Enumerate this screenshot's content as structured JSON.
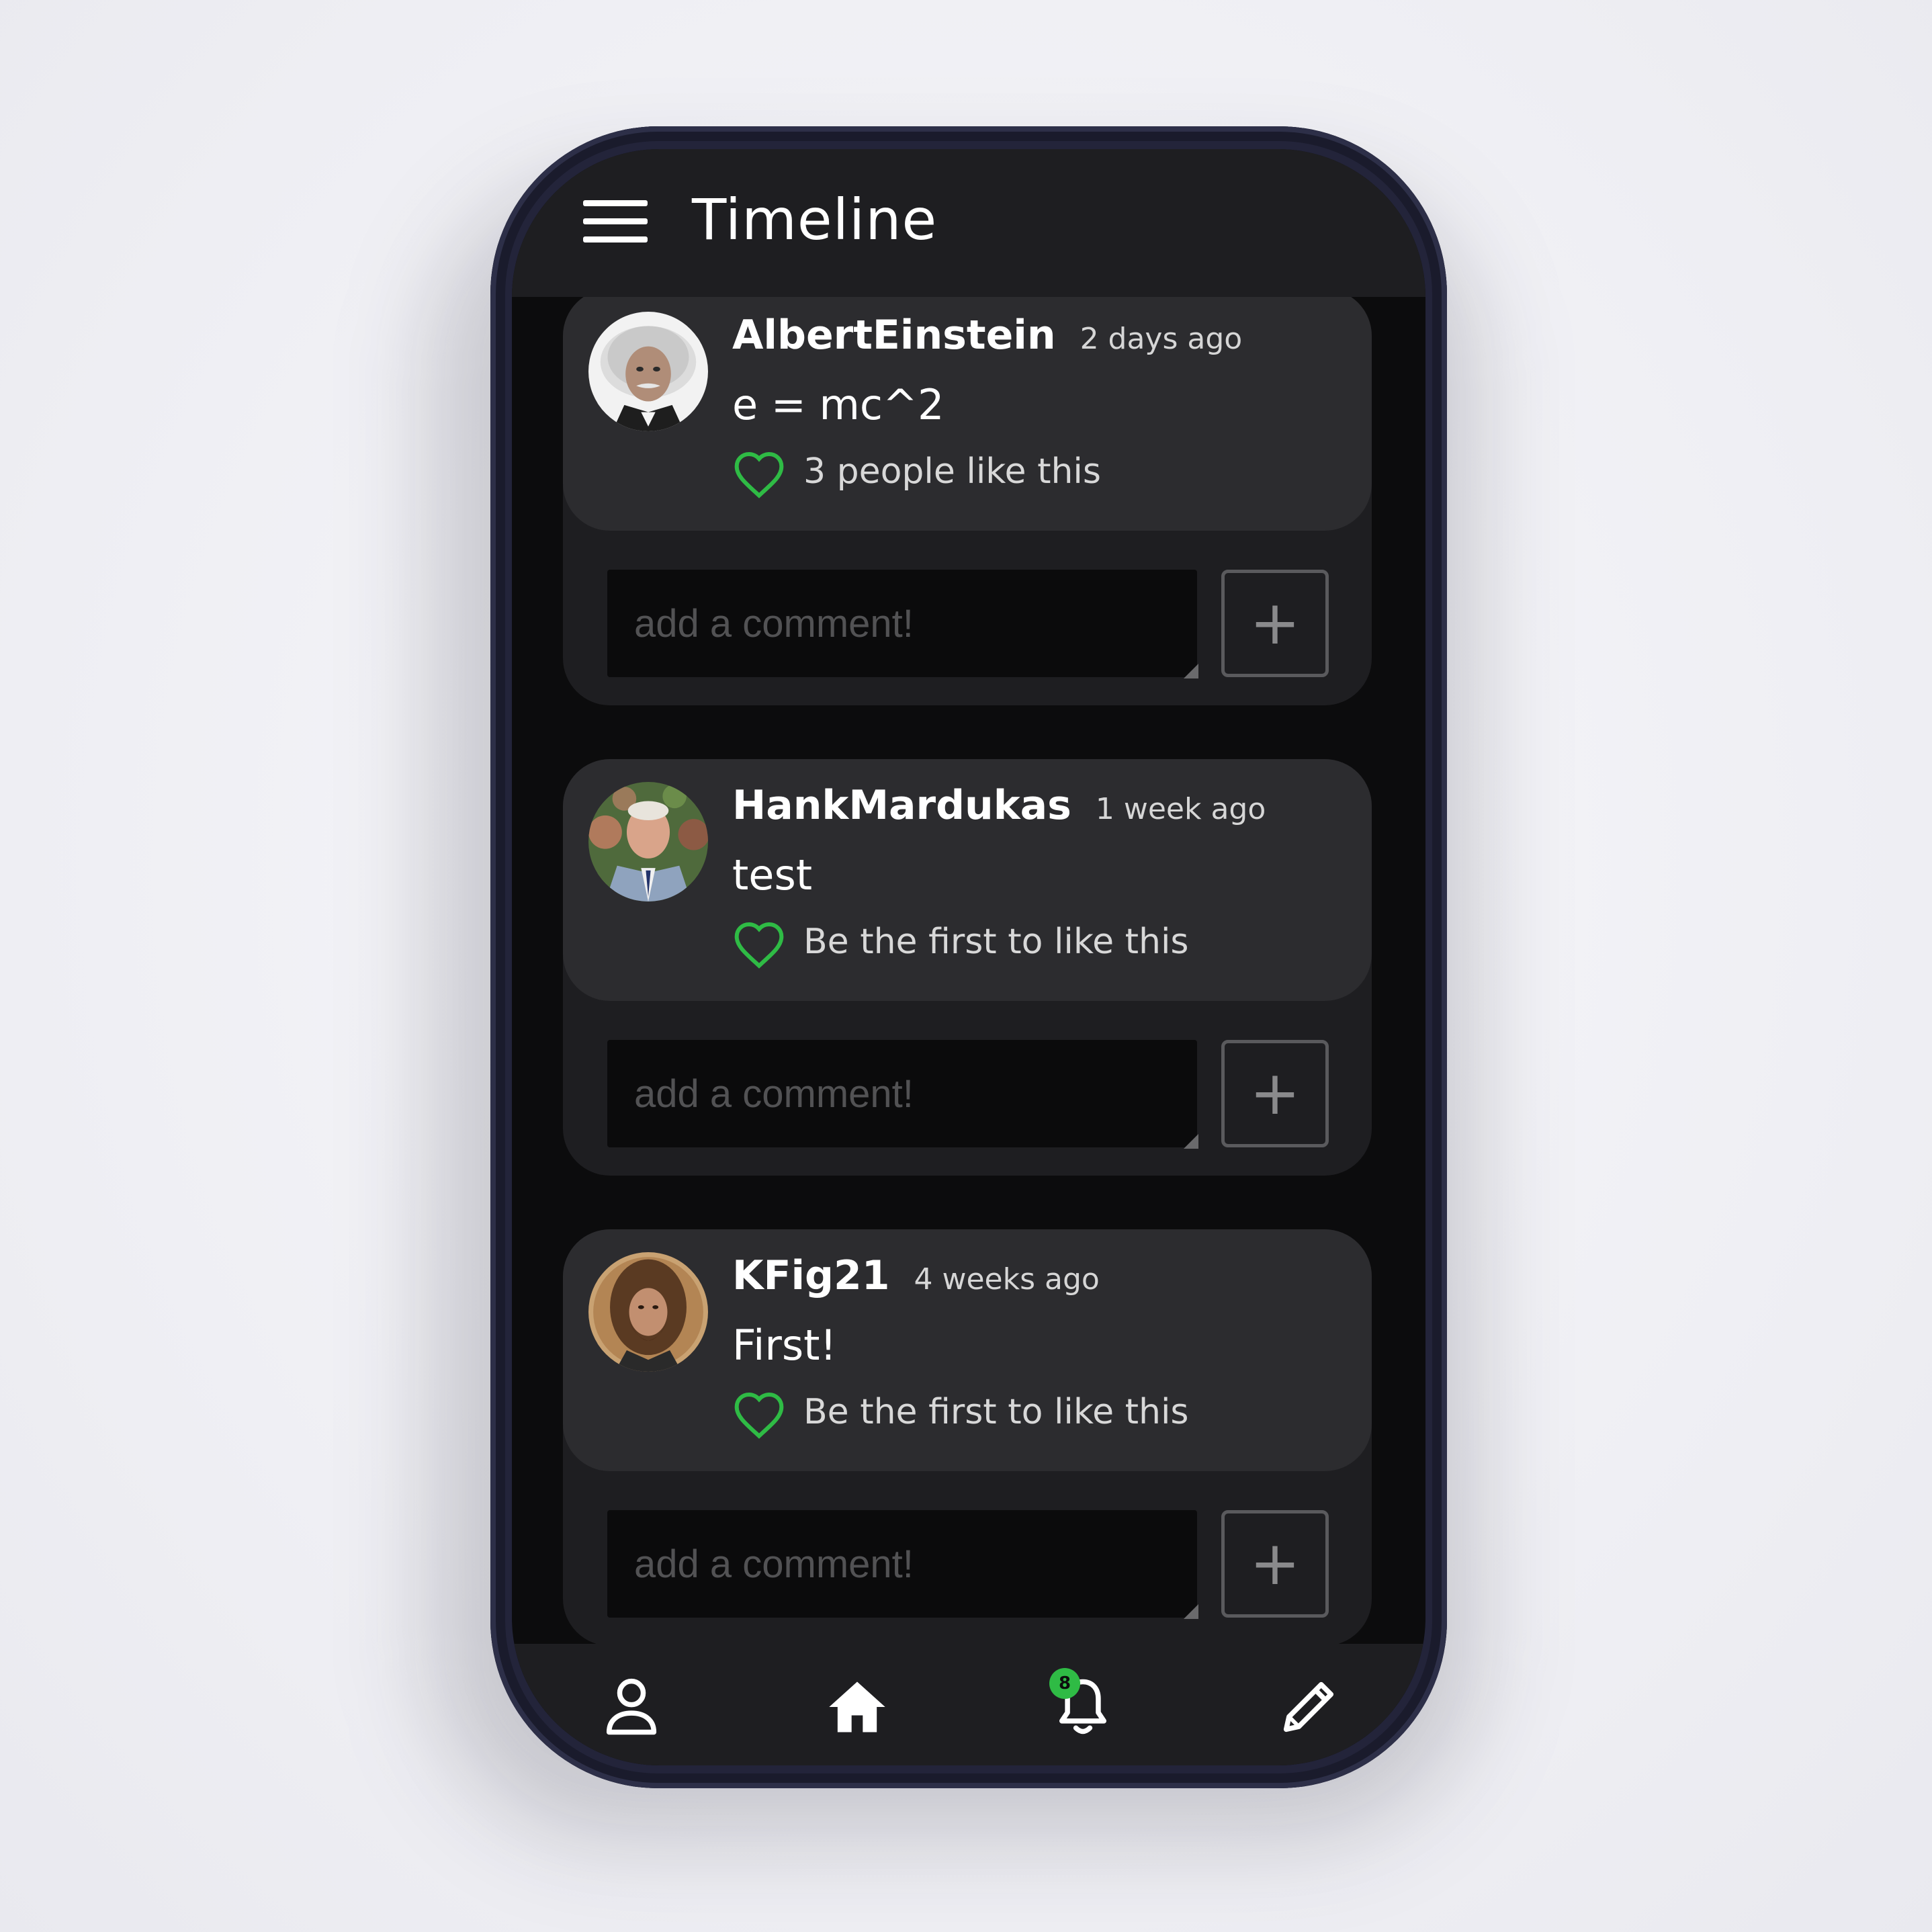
{
  "header": {
    "title": "Timeline"
  },
  "colors": {
    "accent": "#2fbb45",
    "card": "#1e1e21",
    "card_head": "#2c2c2f",
    "background": "#0c0c0d"
  },
  "posts": [
    {
      "username": "AlbertEinstein",
      "time": "2 days ago",
      "text": "e = mc^2",
      "likes": "3 people like this",
      "comment_placeholder": "add a comment!",
      "add_label": "+"
    },
    {
      "username": "HankMardukas",
      "time": "1 week ago",
      "text": "test",
      "likes": "Be the first to like this",
      "comment_placeholder": "add a comment!",
      "add_label": "+"
    },
    {
      "username": "KFig21",
      "time": "4 weeks ago",
      "text": "First!",
      "likes": "Be the first to like this",
      "comment_placeholder": "add a comment!",
      "add_label": "+"
    }
  ],
  "bottom_nav": {
    "items": [
      {
        "icon": "profile-icon"
      },
      {
        "icon": "home-icon"
      },
      {
        "icon": "bell-icon",
        "badge": "8"
      },
      {
        "icon": "pencil-icon"
      }
    ]
  }
}
